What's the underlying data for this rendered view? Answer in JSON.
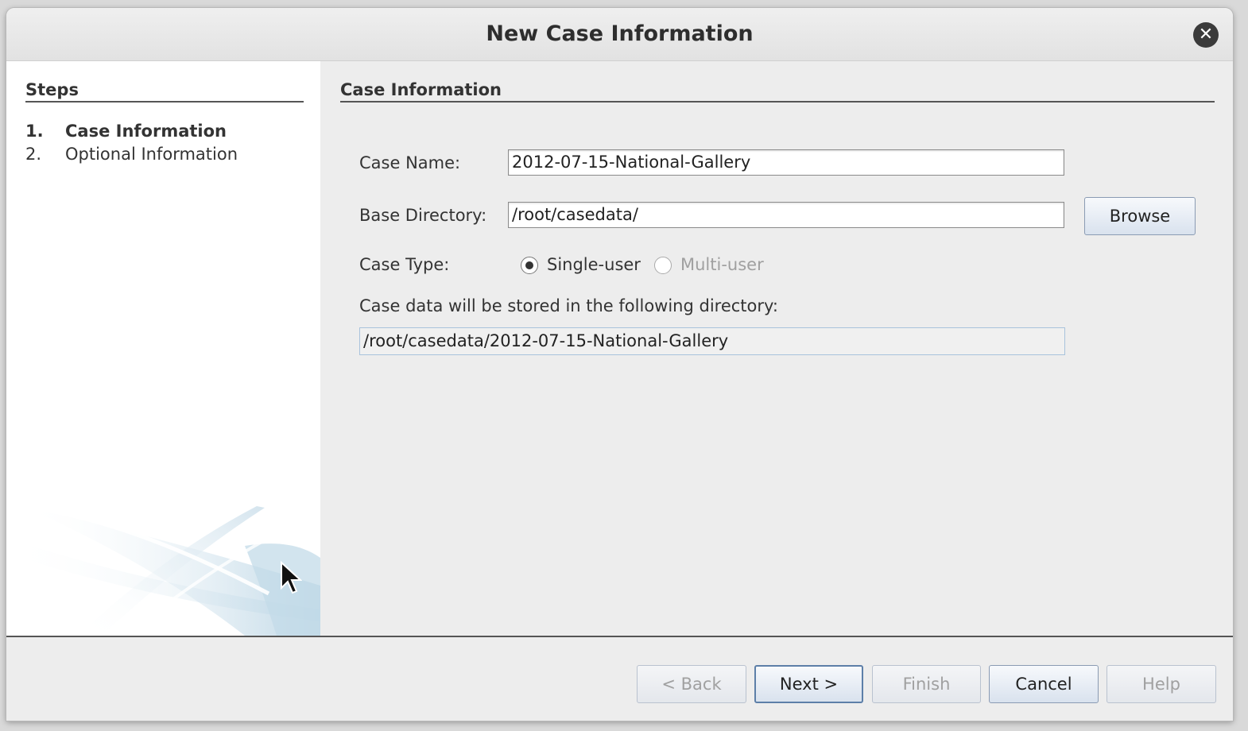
{
  "window": {
    "title": "New Case Information",
    "close_icon": "close-icon"
  },
  "steps": {
    "heading": "Steps",
    "items": [
      {
        "number": "1.",
        "label": "Case Information",
        "active": true
      },
      {
        "number": "2.",
        "label": "Optional Information",
        "active": false
      }
    ]
  },
  "case_info": {
    "heading": "Case Information",
    "case_name_label": "Case Name:",
    "case_name_value": "2012-07-15-National-Gallery",
    "base_dir_label": "Base Directory:",
    "base_dir_value": "/root/casedata/",
    "browse_label": "Browse",
    "case_type_label": "Case Type:",
    "case_type_options": [
      {
        "label": "Single-user",
        "selected": true,
        "enabled": true
      },
      {
        "label": "Multi-user",
        "selected": false,
        "enabled": false
      }
    ],
    "storage_label": "Case data will be stored in the following directory:",
    "storage_value": "/root/casedata/2012-07-15-National-Gallery"
  },
  "footer": {
    "back_label": "< Back",
    "next_label": "Next >",
    "finish_label": "Finish",
    "cancel_label": "Cancel",
    "help_label": "Help"
  }
}
